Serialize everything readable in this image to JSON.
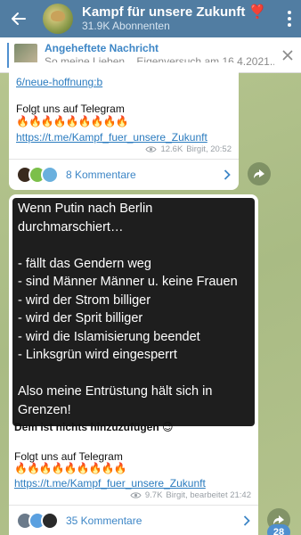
{
  "header": {
    "title": "Kampf für unsere Zukunft",
    "title_heart": "❣️",
    "subtitle": "31.9K Abonnenten"
  },
  "pinned": {
    "title": "Angeheftete Nachricht",
    "text": "So meine Lieben... Eigenversuch am 16.4.2021..."
  },
  "post1": {
    "link_fragment": "6/neue-hoffnung:b",
    "follow_text": "Folgt uns auf Telegram",
    "fire": "🔥🔥🔥🔥🔥🔥🔥🔥🔥",
    "link": "https://t.me/Kampf_fuer_unsere_Zukunft",
    "views": "12.6K",
    "author_time": "Birgit, 20:52",
    "comments": "8 Kommentare"
  },
  "post2": {
    "screenshot_text": "Wenn Putin nach Berlin durchmarschiert…\n\n- fällt das Gendern weg\n- sind Männer Männer u. keine Frauen\n- wird der Strom billiger\n- wird der Sprit billiger\n- wird die Islamisierung beendet\n- Linksgrün wird eingesperrt\n\nAlso meine Entrüstung hält sich in Grenzen!",
    "caption": "Dem ist nichts hinzuzufügen 😉",
    "follow_text": "Folgt uns auf Telegram",
    "fire": "🔥🔥🔥🔥🔥🔥🔥🔥🔥",
    "link": "https://t.me/Kampf_fuer_unsere_Zukunft",
    "views": "9.7K",
    "author_time": "Birgit, bearbeitet 21:42",
    "comments": "35 Kommentare"
  },
  "unread_badge": "28"
}
